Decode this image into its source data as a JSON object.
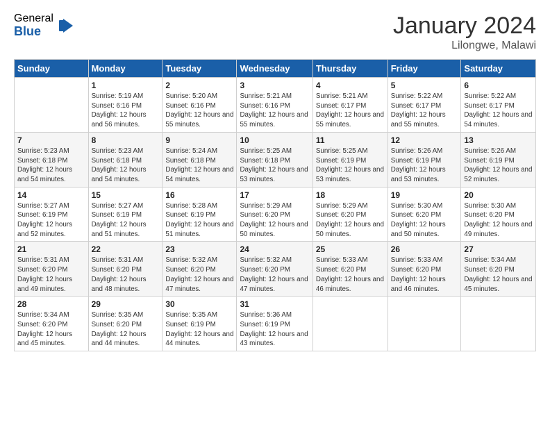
{
  "logo": {
    "general": "General",
    "blue": "Blue"
  },
  "title": "January 2024",
  "location": "Lilongwe, Malawi",
  "days_header": [
    "Sunday",
    "Monday",
    "Tuesday",
    "Wednesday",
    "Thursday",
    "Friday",
    "Saturday"
  ],
  "weeks": [
    [
      {
        "day": "",
        "sunrise": "",
        "sunset": "",
        "daylight": ""
      },
      {
        "day": "1",
        "sunrise": "Sunrise: 5:19 AM",
        "sunset": "Sunset: 6:16 PM",
        "daylight": "Daylight: 12 hours and 56 minutes."
      },
      {
        "day": "2",
        "sunrise": "Sunrise: 5:20 AM",
        "sunset": "Sunset: 6:16 PM",
        "daylight": "Daylight: 12 hours and 55 minutes."
      },
      {
        "day": "3",
        "sunrise": "Sunrise: 5:21 AM",
        "sunset": "Sunset: 6:16 PM",
        "daylight": "Daylight: 12 hours and 55 minutes."
      },
      {
        "day": "4",
        "sunrise": "Sunrise: 5:21 AM",
        "sunset": "Sunset: 6:17 PM",
        "daylight": "Daylight: 12 hours and 55 minutes."
      },
      {
        "day": "5",
        "sunrise": "Sunrise: 5:22 AM",
        "sunset": "Sunset: 6:17 PM",
        "daylight": "Daylight: 12 hours and 55 minutes."
      },
      {
        "day": "6",
        "sunrise": "Sunrise: 5:22 AM",
        "sunset": "Sunset: 6:17 PM",
        "daylight": "Daylight: 12 hours and 54 minutes."
      }
    ],
    [
      {
        "day": "7",
        "sunrise": "Sunrise: 5:23 AM",
        "sunset": "Sunset: 6:18 PM",
        "daylight": "Daylight: 12 hours and 54 minutes."
      },
      {
        "day": "8",
        "sunrise": "Sunrise: 5:23 AM",
        "sunset": "Sunset: 6:18 PM",
        "daylight": "Daylight: 12 hours and 54 minutes."
      },
      {
        "day": "9",
        "sunrise": "Sunrise: 5:24 AM",
        "sunset": "Sunset: 6:18 PM",
        "daylight": "Daylight: 12 hours and 54 minutes."
      },
      {
        "day": "10",
        "sunrise": "Sunrise: 5:25 AM",
        "sunset": "Sunset: 6:18 PM",
        "daylight": "Daylight: 12 hours and 53 minutes."
      },
      {
        "day": "11",
        "sunrise": "Sunrise: 5:25 AM",
        "sunset": "Sunset: 6:19 PM",
        "daylight": "Daylight: 12 hours and 53 minutes."
      },
      {
        "day": "12",
        "sunrise": "Sunrise: 5:26 AM",
        "sunset": "Sunset: 6:19 PM",
        "daylight": "Daylight: 12 hours and 53 minutes."
      },
      {
        "day": "13",
        "sunrise": "Sunrise: 5:26 AM",
        "sunset": "Sunset: 6:19 PM",
        "daylight": "Daylight: 12 hours and 52 minutes."
      }
    ],
    [
      {
        "day": "14",
        "sunrise": "Sunrise: 5:27 AM",
        "sunset": "Sunset: 6:19 PM",
        "daylight": "Daylight: 12 hours and 52 minutes."
      },
      {
        "day": "15",
        "sunrise": "Sunrise: 5:27 AM",
        "sunset": "Sunset: 6:19 PM",
        "daylight": "Daylight: 12 hours and 51 minutes."
      },
      {
        "day": "16",
        "sunrise": "Sunrise: 5:28 AM",
        "sunset": "Sunset: 6:19 PM",
        "daylight": "Daylight: 12 hours and 51 minutes."
      },
      {
        "day": "17",
        "sunrise": "Sunrise: 5:29 AM",
        "sunset": "Sunset: 6:20 PM",
        "daylight": "Daylight: 12 hours and 50 minutes."
      },
      {
        "day": "18",
        "sunrise": "Sunrise: 5:29 AM",
        "sunset": "Sunset: 6:20 PM",
        "daylight": "Daylight: 12 hours and 50 minutes."
      },
      {
        "day": "19",
        "sunrise": "Sunrise: 5:30 AM",
        "sunset": "Sunset: 6:20 PM",
        "daylight": "Daylight: 12 hours and 50 minutes."
      },
      {
        "day": "20",
        "sunrise": "Sunrise: 5:30 AM",
        "sunset": "Sunset: 6:20 PM",
        "daylight": "Daylight: 12 hours and 49 minutes."
      }
    ],
    [
      {
        "day": "21",
        "sunrise": "Sunrise: 5:31 AM",
        "sunset": "Sunset: 6:20 PM",
        "daylight": "Daylight: 12 hours and 49 minutes."
      },
      {
        "day": "22",
        "sunrise": "Sunrise: 5:31 AM",
        "sunset": "Sunset: 6:20 PM",
        "daylight": "Daylight: 12 hours and 48 minutes."
      },
      {
        "day": "23",
        "sunrise": "Sunrise: 5:32 AM",
        "sunset": "Sunset: 6:20 PM",
        "daylight": "Daylight: 12 hours and 47 minutes."
      },
      {
        "day": "24",
        "sunrise": "Sunrise: 5:32 AM",
        "sunset": "Sunset: 6:20 PM",
        "daylight": "Daylight: 12 hours and 47 minutes."
      },
      {
        "day": "25",
        "sunrise": "Sunrise: 5:33 AM",
        "sunset": "Sunset: 6:20 PM",
        "daylight": "Daylight: 12 hours and 46 minutes."
      },
      {
        "day": "26",
        "sunrise": "Sunrise: 5:33 AM",
        "sunset": "Sunset: 6:20 PM",
        "daylight": "Daylight: 12 hours and 46 minutes."
      },
      {
        "day": "27",
        "sunrise": "Sunrise: 5:34 AM",
        "sunset": "Sunset: 6:20 PM",
        "daylight": "Daylight: 12 hours and 45 minutes."
      }
    ],
    [
      {
        "day": "28",
        "sunrise": "Sunrise: 5:34 AM",
        "sunset": "Sunset: 6:20 PM",
        "daylight": "Daylight: 12 hours and 45 minutes."
      },
      {
        "day": "29",
        "sunrise": "Sunrise: 5:35 AM",
        "sunset": "Sunset: 6:20 PM",
        "daylight": "Daylight: 12 hours and 44 minutes."
      },
      {
        "day": "30",
        "sunrise": "Sunrise: 5:35 AM",
        "sunset": "Sunset: 6:19 PM",
        "daylight": "Daylight: 12 hours and 44 minutes."
      },
      {
        "day": "31",
        "sunrise": "Sunrise: 5:36 AM",
        "sunset": "Sunset: 6:19 PM",
        "daylight": "Daylight: 12 hours and 43 minutes."
      },
      {
        "day": "",
        "sunrise": "",
        "sunset": "",
        "daylight": ""
      },
      {
        "day": "",
        "sunrise": "",
        "sunset": "",
        "daylight": ""
      },
      {
        "day": "",
        "sunrise": "",
        "sunset": "",
        "daylight": ""
      }
    ]
  ]
}
